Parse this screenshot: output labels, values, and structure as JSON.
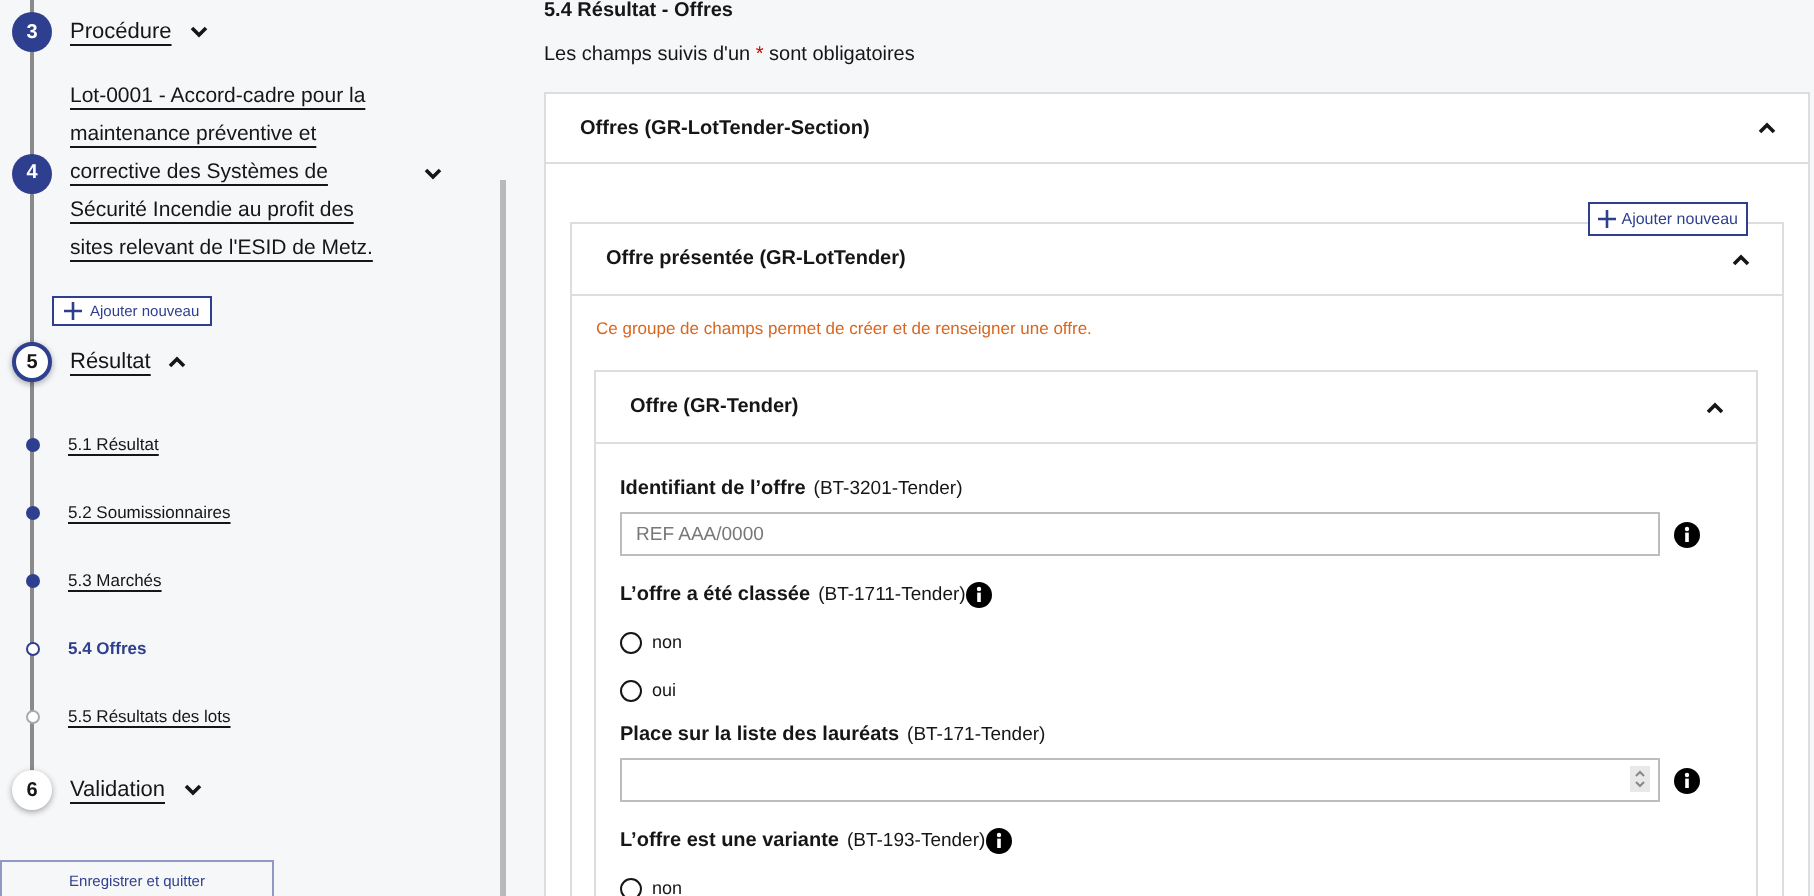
{
  "sidebar": {
    "steps": [
      {
        "number": "3",
        "label": "Procédure",
        "completed": true,
        "selected": false,
        "expanded": false
      },
      {
        "number": "4",
        "label": "Lot-0001 - Accord-cadre pour la maintenance préventive et corrective des Systèmes de Sécurité Incendie au profit des sites relevant de l'ESID de Metz.",
        "completed": true,
        "selected": false,
        "expanded": false,
        "add_button": "Ajouter nouveau"
      },
      {
        "number": "5",
        "label": "Résultat",
        "completed": false,
        "selected": true,
        "expanded": true,
        "children": [
          {
            "label": "5.1 Résultat",
            "completed": true,
            "selected": false
          },
          {
            "label": "5.2 Soumissionnaires",
            "completed": true,
            "selected": false
          },
          {
            "label": "5.3 Marchés",
            "completed": true,
            "selected": false
          },
          {
            "label": "5.4 Offres",
            "completed": false,
            "selected": true
          },
          {
            "label": "5.5 Résultats des lots",
            "completed": false,
            "selected": false
          }
        ]
      },
      {
        "number": "6",
        "label": "Validation",
        "completed": false,
        "selected": false,
        "expanded": false
      }
    ],
    "save_button": "Enregistrer et quitter"
  },
  "page": {
    "title": "5.4 Résultat - Offres",
    "note_before": "Les champs suivis d'un",
    "note_mark": "*",
    "note_after": "sont obligatoires"
  },
  "section": {
    "title": "Offres (GR-LotTender-Section)",
    "expanded": true,
    "add_button": "Ajouter nouveau",
    "group": {
      "title": "Offre présentée (GR-LotTender)",
      "expanded": true,
      "description": "Ce groupe de champs permet de créer et de renseigner une offre.",
      "subgroup": {
        "title": "Offre (GR-Tender)",
        "expanded": true,
        "fields": [
          {
            "kind": "text",
            "label": "Identifiant de l’offre",
            "code": "(BT-3201-Tender)",
            "placeholder": "REF AAA/0000"
          },
          {
            "kind": "radio",
            "label": "L’offre a été classée",
            "code": "(BT-1711-Tender)",
            "options": [
              {
                "label": "non",
                "selected": false
              },
              {
                "label": "oui",
                "selected": false
              }
            ]
          },
          {
            "kind": "number",
            "label": "Place sur la liste des lauréats",
            "code": "(BT-171-Tender)"
          },
          {
            "kind": "radio",
            "label": "L’offre est une variante",
            "code": "(BT-193-Tender)",
            "options": [
              {
                "label": "non",
                "selected": false
              }
            ]
          }
        ]
      }
    }
  }
}
